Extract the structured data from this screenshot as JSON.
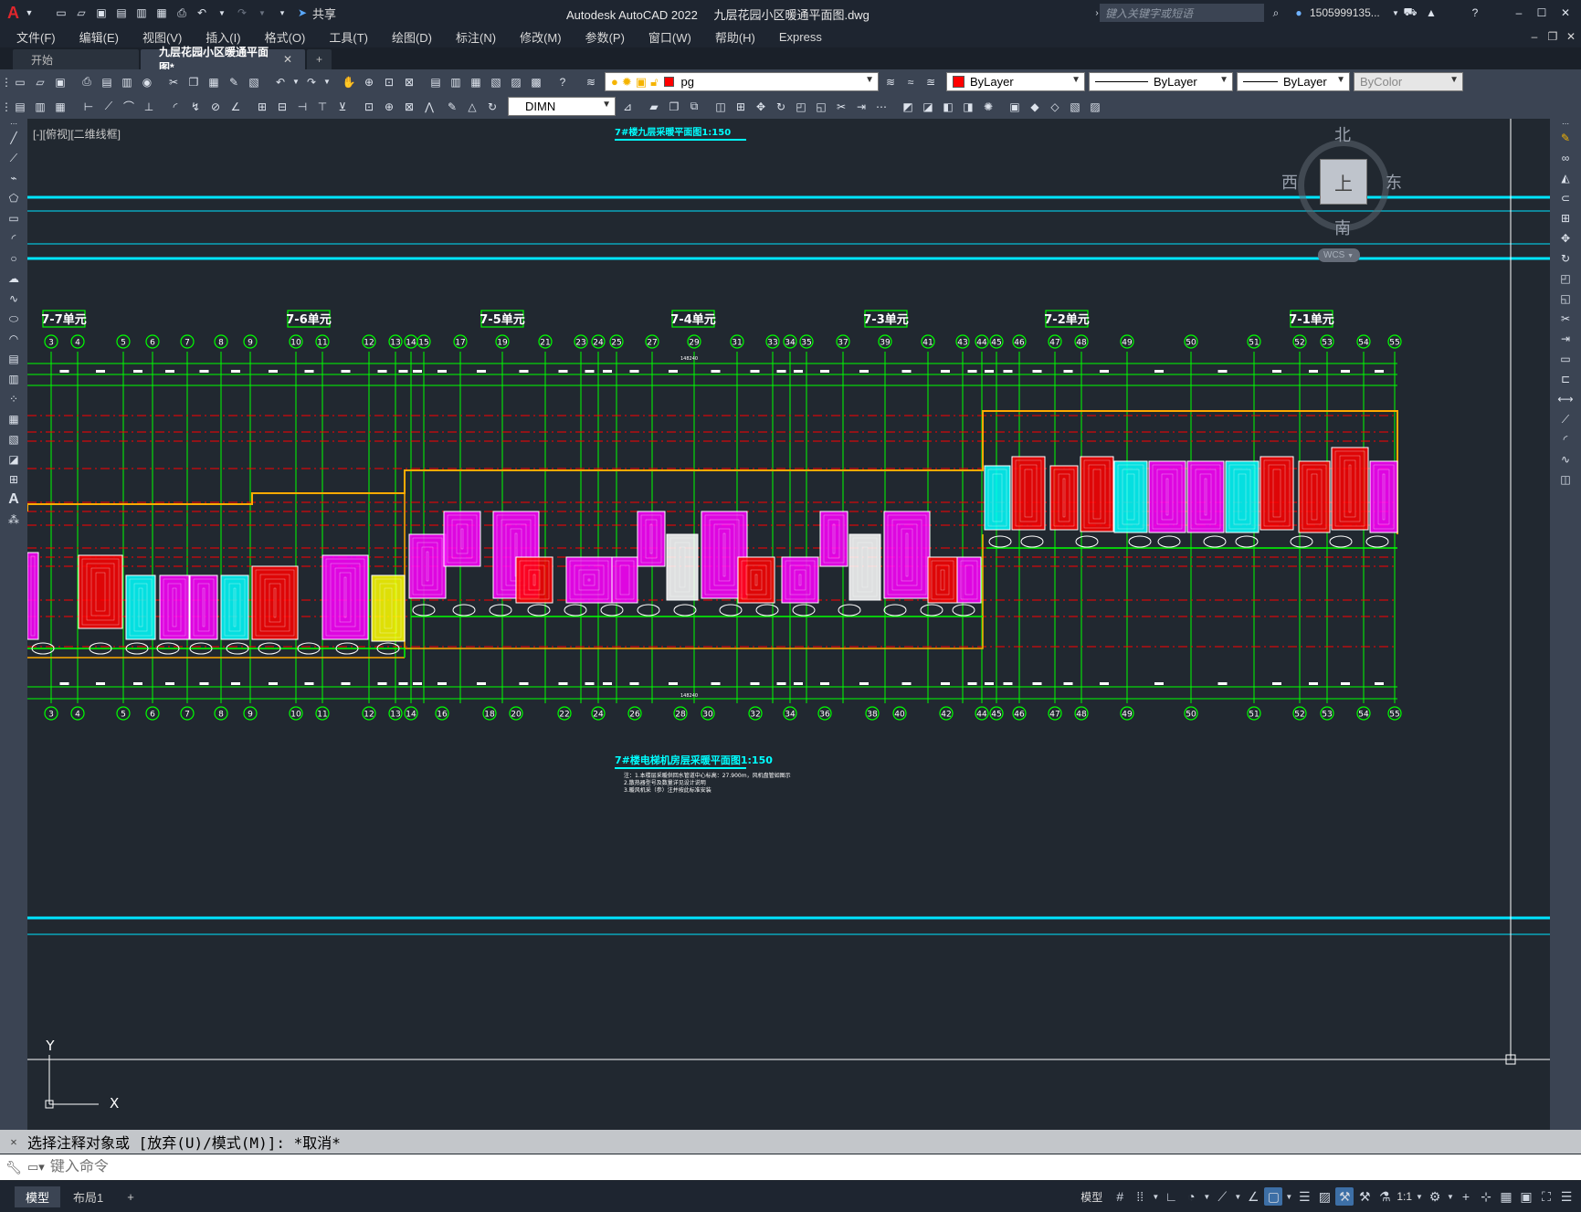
{
  "title": {
    "app": "Autodesk AutoCAD 2022",
    "file": "九层花园小区暖通平面图.dwg",
    "share": "共享",
    "search_placeholder": "键入关键字或短语",
    "user": "1505999135..."
  },
  "menu": [
    "文件(F)",
    "编辑(E)",
    "视图(V)",
    "插入(I)",
    "格式(O)",
    "工具(T)",
    "绘图(D)",
    "标注(N)",
    "修改(M)",
    "参数(P)",
    "窗口(W)",
    "帮助(H)",
    "Express"
  ],
  "tabs": [
    {
      "label": "开始",
      "active": false
    },
    {
      "label": "九层花园小区暖通平面图*",
      "active": true
    }
  ],
  "toolbar": {
    "layer": "pg",
    "color": "ByLayer",
    "linetype": "ByLayer",
    "lineweight": "ByLayer",
    "plotstyle": "ByColor",
    "dimstyle": "DIMN"
  },
  "viewport": {
    "label": "[-][俯视][二维线框]",
    "compass": {
      "n": "北",
      "s": "南",
      "e": "东",
      "w": "西",
      "top": "上",
      "wcs": "WCS"
    },
    "ucs_y": "Y",
    "ucs_x": "X"
  },
  "drawing": {
    "title_top": "7#楼九层采暖平面图1:150",
    "title_bottom": "7#楼电梯机房层采暖平面图1:150",
    "notes": [
      "注：1.本楼层采暖供回水管道中心标高：27.900m，风机盘管如图示",
      "2.散热器型号及数量详见设计说明",
      "3.暖风机采（参）注并按此标准安装"
    ],
    "units": [
      "7-7单元",
      "7-6单元",
      "7-5单元",
      "7-4单元",
      "7-3单元",
      "7-2单元",
      "7-1单元"
    ],
    "axes_top": [
      "3",
      "4",
      "5",
      "6",
      "7",
      "8",
      "9",
      "10",
      "11",
      "12",
      "13",
      "14",
      "15",
      "17",
      "19",
      "21",
      "23",
      "24",
      "25",
      "27",
      "29",
      "31",
      "33",
      "34",
      "35",
      "37",
      "39",
      "41",
      "43",
      "44",
      "45",
      "46",
      "47",
      "48",
      "49",
      "50",
      "51",
      "52",
      "53",
      "54",
      "55"
    ],
    "axes_bottom": [
      "3",
      "4",
      "5",
      "6",
      "7",
      "8",
      "9",
      "10",
      "11",
      "12",
      "13",
      "14",
      "16",
      "18",
      "20",
      "22",
      "24",
      "26",
      "28",
      "30",
      "32",
      "34",
      "36",
      "38",
      "40",
      "42",
      "44",
      "45",
      "46",
      "47",
      "48",
      "49",
      "50",
      "51",
      "52",
      "53",
      "54",
      "55"
    ],
    "total_dim": "148240",
    "colors": {
      "cyan": "#00ffff",
      "green": "#00ff00",
      "red": "#ff0000",
      "magenta": "#ff00ff",
      "yellow": "#ffff00",
      "orange": "#ffaa00",
      "white": "#ffffff"
    }
  },
  "command": {
    "history": "选择注释对象或 [放弃(U)/模式(M)]: *取消*",
    "placeholder": "键入命令"
  },
  "status": {
    "tabs": [
      "模型",
      "布局1"
    ],
    "model_label": "模型",
    "scale": "1:1"
  }
}
